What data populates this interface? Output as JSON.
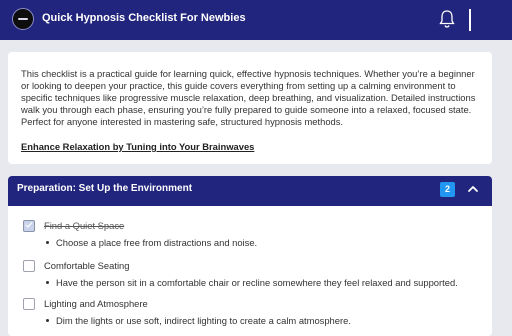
{
  "header": {
    "title": "Quick Hypnosis Checklist For Newbies",
    "logo_icon": "logo-icon",
    "bell_icon": "bell-icon",
    "color": "#22257d"
  },
  "intro": {
    "text": "This checklist is a practical guide for learning quick, effective hypnosis techniques. Whether you’re a beginner or looking to deepen your practice, this guide covers everything from setting up a calming environment to specific techniques like progressive muscle relaxation, deep breathing, and visualization. Detailed instructions walk you through each phase, ensuring you’re fully prepared to guide someone into a relaxed, focused state. Perfect for anyone interested in mastering safe, structured hypnosis methods.",
    "link_text": "Enhance Relaxation by Tuning into Your Brainwaves"
  },
  "section": {
    "title": "Preparation: Set Up the Environment",
    "badge": "2",
    "badge_color": "#2196f3",
    "collapse_icon": "chevron-up-icon",
    "items": [
      {
        "label": "Find a Quiet Space",
        "checked": true,
        "description": "Choose a place free from distractions and noise."
      },
      {
        "label": "Comfortable Seating",
        "checked": false,
        "description": "Have the person sit in a comfortable chair or recline somewhere they feel relaxed and supported."
      },
      {
        "label": "Lighting and Atmosphere",
        "checked": false,
        "description": "Dim the lights or use soft, indirect lighting to create a calm atmosphere."
      }
    ]
  }
}
